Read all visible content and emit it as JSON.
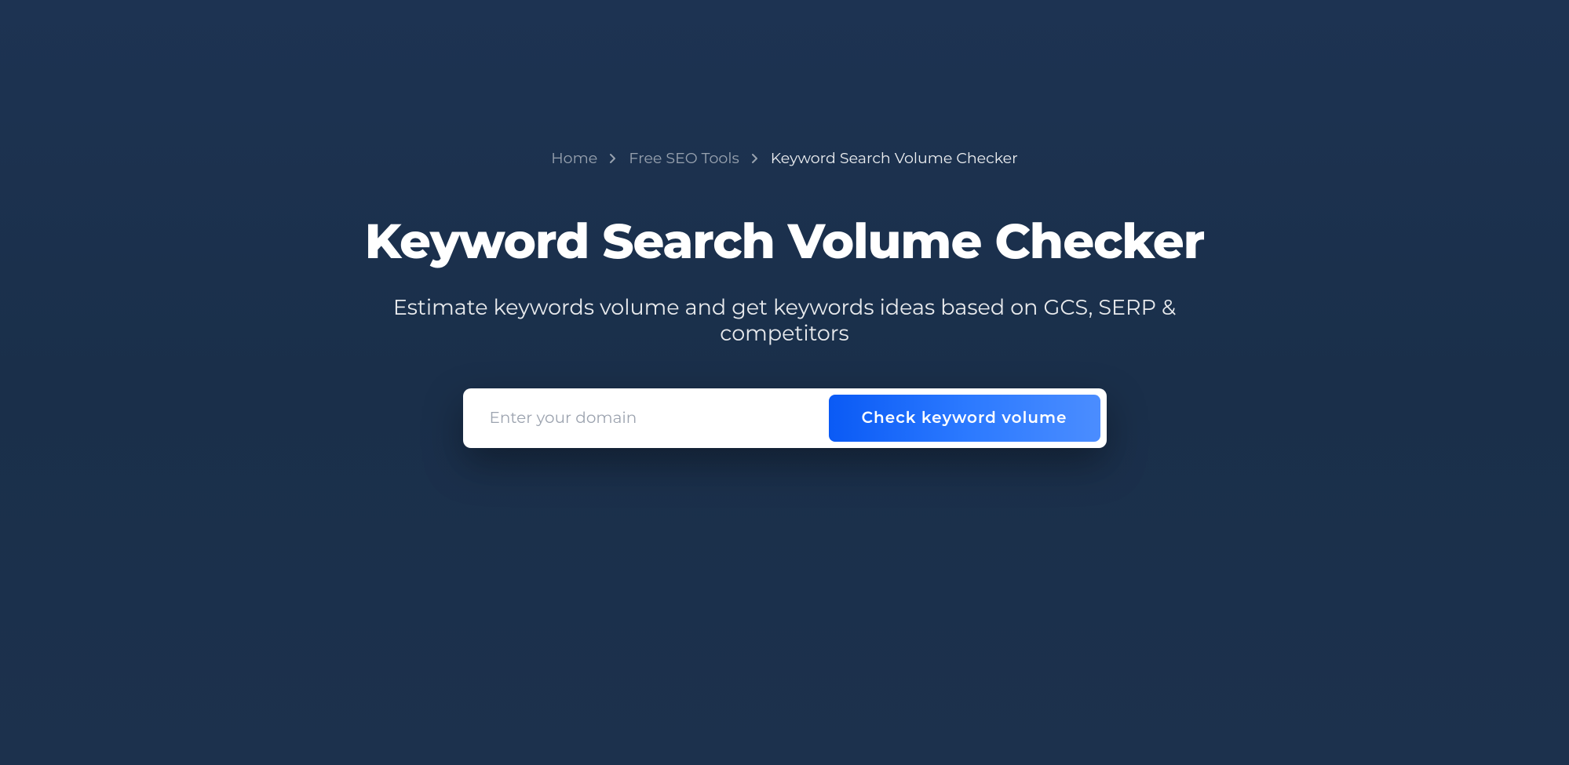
{
  "breadcrumb": {
    "items": [
      {
        "label": "Home"
      },
      {
        "label": "Free SEO Tools"
      }
    ],
    "current": "Keyword Search Volume Checker"
  },
  "hero": {
    "title": "Keyword Search Volume Checker",
    "subtitle": "Estimate keywords volume and get keywords ideas based on GCS, SERP & competitors"
  },
  "form": {
    "input_placeholder": "Enter your domain",
    "input_value": "",
    "submit_label": "Check keyword volume"
  }
}
